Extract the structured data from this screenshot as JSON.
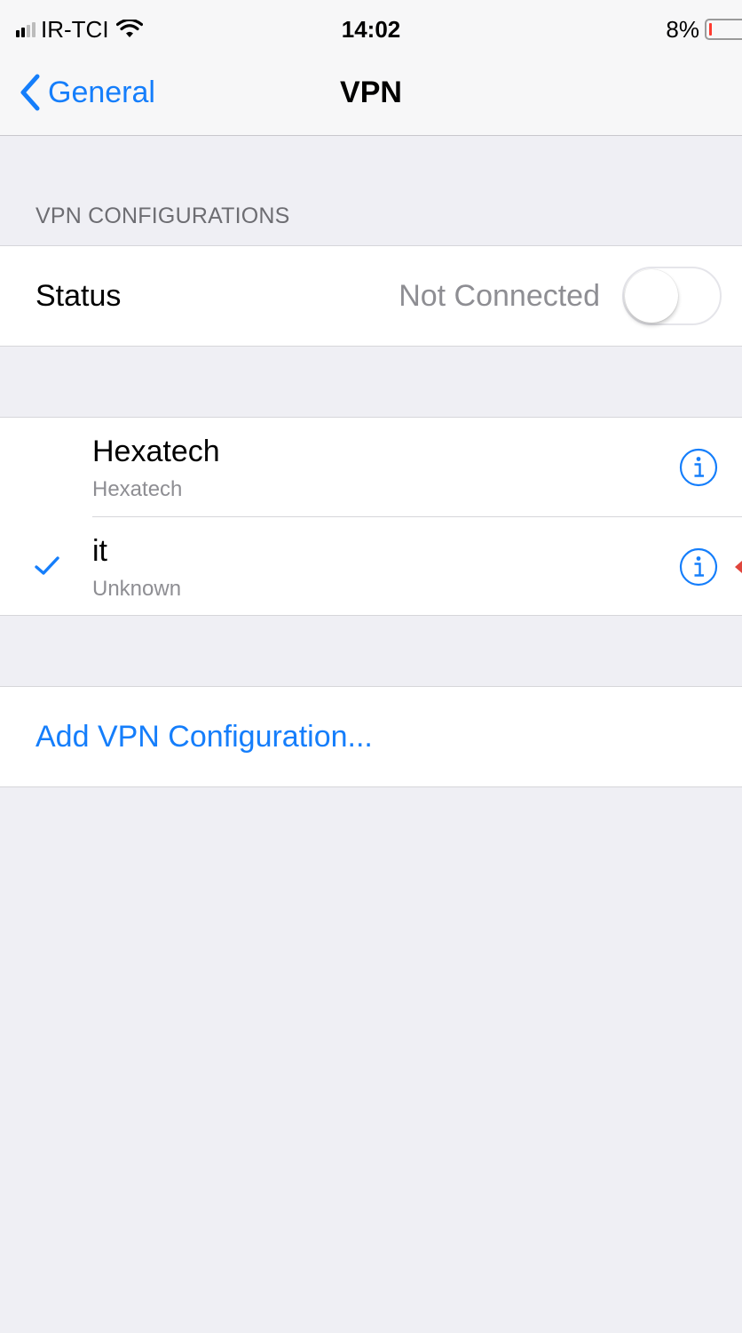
{
  "status_bar": {
    "carrier": "IR-TCI",
    "time": "14:02",
    "battery_percent": "8%",
    "battery_level": 0.08,
    "signal_bars_active": 2,
    "signal_bars_total": 4,
    "icons": [
      "signal-bars-icon",
      "wifi-icon",
      "battery-icon"
    ]
  },
  "nav": {
    "back_label": "General",
    "title": "VPN",
    "back_icon": "chevron-left-icon"
  },
  "section": {
    "header": "VPN CONFIGURATIONS"
  },
  "status_row": {
    "label": "Status",
    "value": "Not Connected",
    "toggle_on": false
  },
  "vpn_configs": [
    {
      "name": "Hexatech",
      "type": "Hexatech",
      "selected": false
    },
    {
      "name": "it",
      "type": "Unknown",
      "selected": true
    }
  ],
  "add_config": {
    "label": "Add VPN Configuration..."
  },
  "colors": {
    "accent": "#157efb",
    "background": "#efeff4",
    "secondary_text": "#8e8e93",
    "battery_low": "#ff3b30"
  }
}
